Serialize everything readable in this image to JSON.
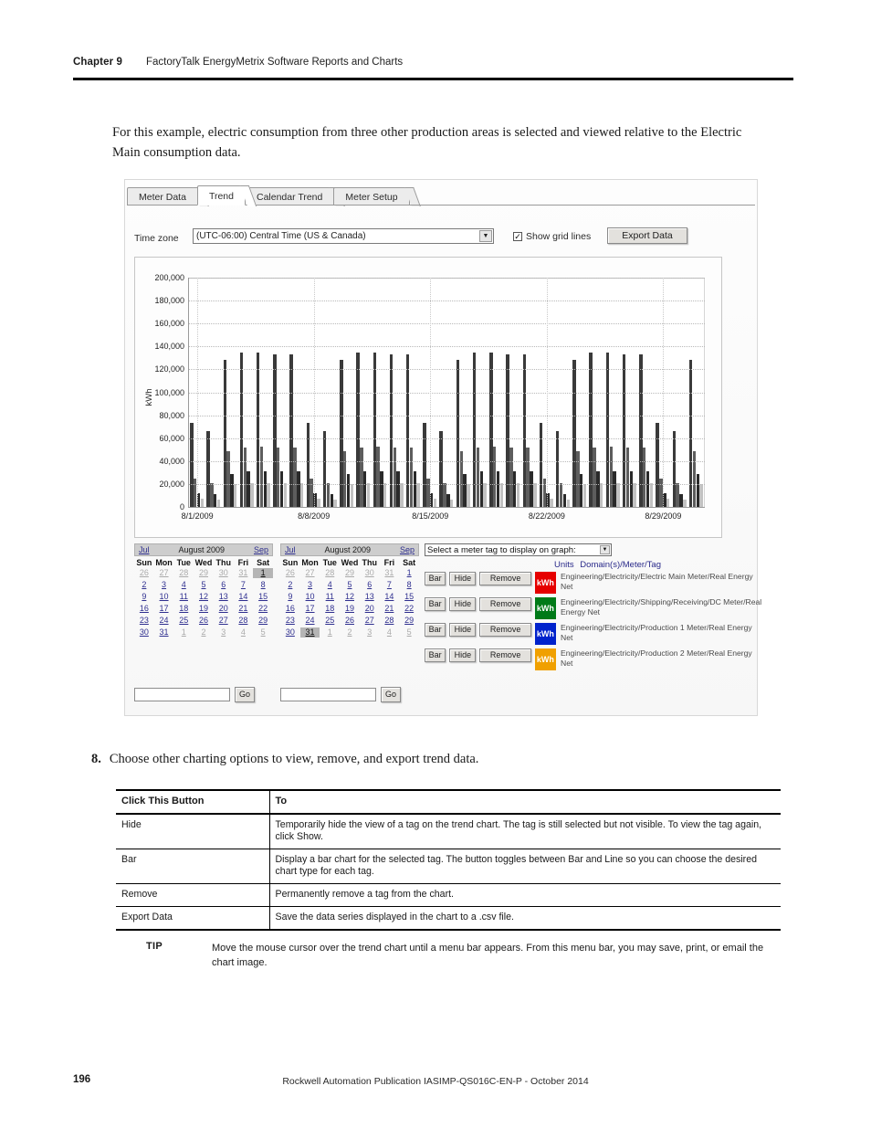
{
  "header": {
    "chapter": "Chapter 9",
    "title": "FactoryTalk EnergyMetrix Software Reports and Charts"
  },
  "intro": "For this example, electric consumption from three other production areas is selected and viewed relative to the Electric Main consumption data.",
  "app": {
    "tabs": [
      {
        "label": "Meter Data",
        "active": false
      },
      {
        "label": "Trend",
        "active": true
      },
      {
        "label": "Calendar Trend",
        "active": false
      },
      {
        "label": "Meter Setup",
        "active": false
      }
    ],
    "toolbar": {
      "timezone_label": "Time zone",
      "timezone_value": "(UTC-06:00) Central Time (US & Canada)",
      "show_grid_lines_label": "Show grid lines",
      "show_grid_lines_checked": "✓",
      "export_label": "Export Data",
      "dropdown_arrow": "▼"
    },
    "calendars": [
      {
        "prev": "Jul",
        "title": "August 2009",
        "next": "Sep",
        "dow": [
          "Sun",
          "Mon",
          "Tue",
          "Wed",
          "Thu",
          "Fri",
          "Sat"
        ],
        "lead": [
          "26",
          "27",
          "28",
          "29",
          "30",
          "31"
        ],
        "days": [
          "1",
          "2",
          "3",
          "4",
          "5",
          "6",
          "7",
          "8",
          "9",
          "10",
          "11",
          "12",
          "13",
          "14",
          "15",
          "16",
          "17",
          "18",
          "19",
          "20",
          "21",
          "22",
          "23",
          "24",
          "25",
          "26",
          "27",
          "28",
          "29",
          "30",
          "31"
        ],
        "trail": [
          "1",
          "2",
          "3",
          "4",
          "5"
        ],
        "selected": "1"
      },
      {
        "prev": "Jul",
        "title": "August 2009",
        "next": "Sep",
        "dow": [
          "Sun",
          "Mon",
          "Tue",
          "Wed",
          "Thu",
          "Fri",
          "Sat"
        ],
        "lead": [
          "26",
          "27",
          "28",
          "29",
          "30",
          "31"
        ],
        "days": [
          "1",
          "2",
          "3",
          "4",
          "5",
          "6",
          "7",
          "8",
          "9",
          "10",
          "11",
          "12",
          "13",
          "14",
          "15",
          "16",
          "17",
          "18",
          "19",
          "20",
          "21",
          "22",
          "23",
          "24",
          "25",
          "26",
          "27",
          "28",
          "29",
          "30",
          "31"
        ],
        "trail": [
          "1",
          "2",
          "3",
          "4",
          "5"
        ],
        "selected": "31"
      }
    ],
    "legend": {
      "select_label": "Select a meter tag to display on graph:",
      "select_arrow": "▼",
      "col_units": "Units",
      "col_tag": "Domain(s)/Meter/Tag",
      "rows": [
        {
          "bar": "Bar",
          "hide": "Hide",
          "remove": "Remove",
          "units": "kWh",
          "color": "#e60000",
          "tag": "Engineering/Electricity/Electric Main Meter/Real Energy Net"
        },
        {
          "bar": "Bar",
          "hide": "Hide",
          "remove": "Remove",
          "units": "kWh",
          "color": "#007a18",
          "tag": "Engineering/Electricity/Shipping/Receiving/DC Meter/Real Energy Net"
        },
        {
          "bar": "Bar",
          "hide": "Hide",
          "remove": "Remove",
          "units": "kWh",
          "color": "#0022cc",
          "tag": "Engineering/Electricity/Production 1 Meter/Real Energy Net"
        },
        {
          "bar": "Bar",
          "hide": "Hide",
          "remove": "Remove",
          "units": "kWh",
          "color": "#f0a000",
          "tag": "Engineering/Electricity/Production 2 Meter/Real Energy Net"
        }
      ]
    },
    "go_row": {
      "input_left_value": "",
      "input_right_value": "",
      "go_label": "Go"
    }
  },
  "chart_data": {
    "type": "bar",
    "title": "",
    "xlabel": "",
    "ylabel": "kWh",
    "ylim": [
      0,
      200000
    ],
    "yticks": [
      "0",
      "20,000",
      "40,000",
      "60,000",
      "80,000",
      "100,000",
      "120,000",
      "140,000",
      "160,000",
      "180,000",
      "200,000"
    ],
    "grid": true,
    "legend_position": "below",
    "x_tick_labels": [
      "8/1/2009",
      "8/8/2009",
      "8/15/2009",
      "8/22/2009",
      "8/29/2009"
    ],
    "x_tick_indices": [
      0,
      7,
      14,
      21,
      28
    ],
    "categories": [
      "8/1/2009",
      "8/2/2009",
      "8/3/2009",
      "8/4/2009",
      "8/5/2009",
      "8/6/2009",
      "8/7/2009",
      "8/8/2009",
      "8/9/2009",
      "8/10/2009",
      "8/11/2009",
      "8/12/2009",
      "8/13/2009",
      "8/14/2009",
      "8/15/2009",
      "8/16/2009",
      "8/17/2009",
      "8/18/2009",
      "8/19/2009",
      "8/20/2009",
      "8/21/2009",
      "8/22/2009",
      "8/23/2009",
      "8/24/2009",
      "8/25/2009",
      "8/26/2009",
      "8/27/2009",
      "8/28/2009",
      "8/29/2009",
      "8/30/2009",
      "8/31/2009"
    ],
    "series": [
      {
        "name": "Engineering/Electricity/Electric Main Meter/Real Energy Net",
        "color": "#e60000",
        "render_color": "#3a3a3a",
        "values": [
          73000,
          66000,
          128000,
          135000,
          135000,
          133000,
          133000,
          73000,
          66000,
          128000,
          135000,
          135000,
          133000,
          133000,
          73000,
          66000,
          128000,
          135000,
          135000,
          133000,
          133000,
          73000,
          66000,
          128000,
          135000,
          135000,
          133000,
          133000,
          73000,
          66000,
          128000
        ]
      },
      {
        "name": "Engineering/Electricity/Shipping/Receiving/DC Meter/Real Energy Net",
        "color": "#007a18",
        "render_color": "#5d5d5d",
        "values": [
          25000,
          21000,
          49000,
          52000,
          53000,
          52000,
          52000,
          25000,
          21000,
          49000,
          52000,
          53000,
          52000,
          52000,
          25000,
          21000,
          49000,
          52000,
          53000,
          52000,
          52000,
          25000,
          21000,
          49000,
          52000,
          53000,
          52000,
          52000,
          25000,
          21000,
          49000
        ]
      },
      {
        "name": "Engineering/Electricity/Production 1 Meter/Real Energy Net",
        "color": "#0022cc",
        "render_color": "#2a2a2a",
        "values": [
          12000,
          11000,
          29000,
          31000,
          31000,
          31000,
          31000,
          12000,
          11000,
          29000,
          31000,
          31000,
          31000,
          31000,
          12000,
          11000,
          29000,
          31000,
          31000,
          31000,
          31000,
          12000,
          11000,
          29000,
          31000,
          31000,
          31000,
          31000,
          12000,
          11000,
          29000
        ]
      },
      {
        "name": "Engineering/Electricity/Production 2 Meter/Real Energy Net",
        "color": "#f0a000",
        "render_color": "#c2c2c2",
        "values": [
          7000,
          6500,
          20000,
          21000,
          21000,
          21000,
          21000,
          7000,
          6500,
          20000,
          21000,
          21000,
          21000,
          21000,
          7000,
          6500,
          20000,
          21000,
          21000,
          21000,
          21000,
          7000,
          6500,
          20000,
          21000,
          21000,
          21000,
          21000,
          7000,
          6500,
          20000
        ]
      }
    ]
  },
  "step8": {
    "number": "8.",
    "text": "Choose other charting options to view, remove, and export trend data."
  },
  "table": {
    "headers": [
      "Click This Button",
      "To"
    ],
    "rows": [
      [
        "Hide",
        "Temporarily hide the view of a tag on the trend chart. The tag is still selected but not visible. To view the tag again, click Show."
      ],
      [
        "Bar",
        "Display a bar chart for the selected tag. The button toggles between Bar and Line so you can choose the desired chart type for each tag."
      ],
      [
        "Remove",
        "Permanently remove a tag from the chart."
      ],
      [
        "Export Data",
        "Save the data series displayed in the chart to a .csv file."
      ]
    ]
  },
  "tip": {
    "label": "TIP",
    "text": "Move the mouse cursor over the trend chart until a menu bar appears. From this menu bar, you may save, print, or email the chart image."
  },
  "footer": {
    "page": "196",
    "text": "Rockwell Automation Publication IASIMP-QS016C-EN-P - October 2014"
  }
}
